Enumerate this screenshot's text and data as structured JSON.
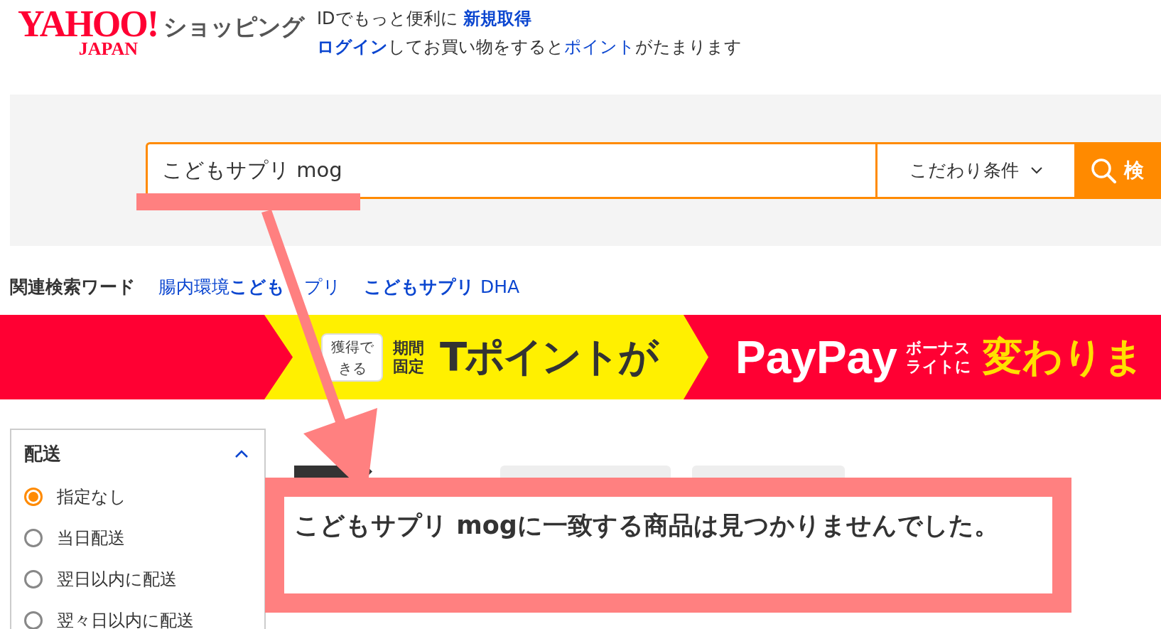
{
  "header": {
    "logo": {
      "brand": "YAHOO!",
      "region": "JAPAN"
    },
    "service": "ショッピング",
    "promo_line1": [
      {
        "text": "IDでもっと便利に ",
        "kind": "plain"
      },
      {
        "text": "新規取得",
        "kind": "link_bold"
      }
    ],
    "promo_line2": [
      {
        "text": "ログイン",
        "kind": "link_bold"
      },
      {
        "text": "してお買い物をすると",
        "kind": "plain"
      },
      {
        "text": "ポイント",
        "kind": "link"
      },
      {
        "text": "がたまります",
        "kind": "plain"
      }
    ]
  },
  "search": {
    "value": "こどもサプリ mog",
    "conditions": "こだわり条件",
    "button": "検"
  },
  "related": {
    "label": "関連検索ワード",
    "words": [
      [
        "腸内環境**こども**",
        "プリ"
      ],
      [
        "**こどもサプリ** DHA"
      ]
    ]
  },
  "banner": {
    "bubble": "獲得できる",
    "period": "期間固定",
    "tpoint": "Tポイントが",
    "paypay": "PayPay",
    "bonus": "ボーナスライトに",
    "change": "変わりま"
  },
  "sidebar": {
    "title": "配送",
    "expanded": true,
    "options": [
      {
        "label": "指定なし",
        "selected": true
      },
      {
        "label": "当日配送",
        "selected": false
      },
      {
        "label": "翌日以内に配送",
        "selected": false
      },
      {
        "label": "翌々日以内に配送",
        "selected": false
      }
    ]
  },
  "result": {
    "message": "こどもサプリ mogに一致する商品は見つかりませんでした。"
  }
}
